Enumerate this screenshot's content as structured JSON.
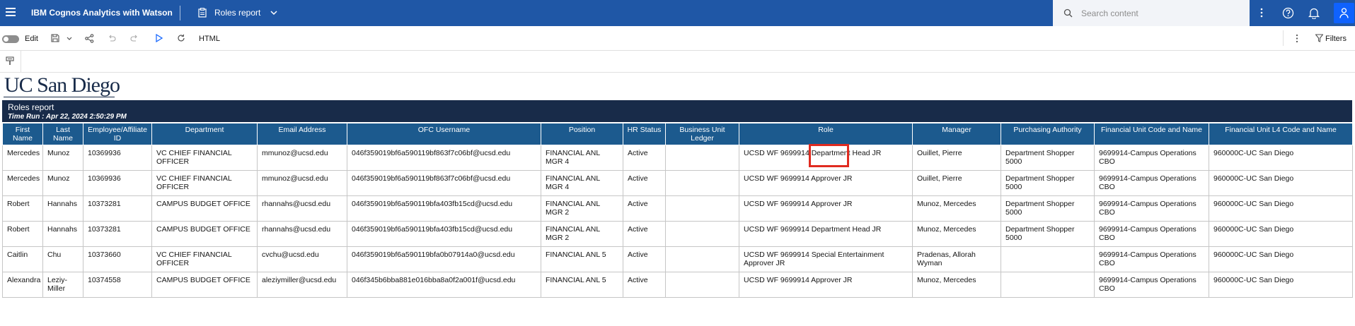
{
  "topbar": {
    "app_name": "IBM Cognos Analytics with Watson",
    "report_title": "Roles report",
    "search_placeholder": "Search content"
  },
  "toolbar": {
    "edit_label": "Edit",
    "output_format": "HTML",
    "filters_label": "Filters"
  },
  "logo": {
    "text": "UC San Diego"
  },
  "report": {
    "title": "Roles report",
    "time_run": "Time Run : Apr 22, 2024 2:50:29 PM"
  },
  "table": {
    "columns": [
      "First Name",
      "Last Name",
      "Employee/Affiliate ID",
      "Department",
      "Email Address",
      "OFC Username",
      "Position",
      "HR Status",
      "Business Unit Ledger",
      "Role",
      "Manager",
      "Purchasing Authority",
      "Financial Unit Code and Name",
      "Financial Unit L4 Code and Name"
    ],
    "rows": [
      [
        "Mercedes",
        "Munoz",
        "10369936",
        "VC CHIEF FINANCIAL OFFICER",
        "mmunoz@ucsd.edu",
        "046f359019bf6a590119bf863f7c06bf@ucsd.edu",
        "FINANCIAL ANL MGR 4",
        "Active",
        "",
        "UCSD WF 9699914 Department Head JR",
        "Ouillet, Pierre",
        "Department Shopper 5000",
        "9699914-Campus Operations CBO",
        "960000C-UC San Diego"
      ],
      [
        "Mercedes",
        "Munoz",
        "10369936",
        "VC CHIEF FINANCIAL OFFICER",
        "mmunoz@ucsd.edu",
        "046f359019bf6a590119bf863f7c06bf@ucsd.edu",
        "FINANCIAL ANL MGR 4",
        "Active",
        "",
        "UCSD WF 9699914 Approver JR",
        "Ouillet, Pierre",
        "Department Shopper 5000",
        "9699914-Campus Operations CBO",
        "960000C-UC San Diego"
      ],
      [
        "Robert",
        "Hannahs",
        "10373281",
        "CAMPUS BUDGET OFFICE",
        "rhannahs@ucsd.edu",
        "046f359019bf6a590119bfa403fb15cd@ucsd.edu",
        "FINANCIAL ANL MGR 2",
        "Active",
        "",
        "UCSD WF 9699914 Approver JR",
        "Munoz, Mercedes",
        "Department Shopper 5000",
        "9699914-Campus Operations CBO",
        "960000C-UC San Diego"
      ],
      [
        "Robert",
        "Hannahs",
        "10373281",
        "CAMPUS BUDGET OFFICE",
        "rhannahs@ucsd.edu",
        "046f359019bf6a590119bfa403fb15cd@ucsd.edu",
        "FINANCIAL ANL MGR 2",
        "Active",
        "",
        "UCSD WF 9699914 Department Head JR",
        "Munoz, Mercedes",
        "Department Shopper 5000",
        "9699914-Campus Operations CBO",
        "960000C-UC San Diego"
      ],
      [
        "Caitlin",
        "Chu",
        "10373660",
        "VC CHIEF FINANCIAL OFFICER",
        "cvchu@ucsd.edu",
        "046f359019bf6a590119bfa0b07914a0@ucsd.edu",
        "FINANCIAL ANL 5",
        "Active",
        "",
        "UCSD WF 9699914 Special Entertainment Approver JR",
        "Pradenas, Allorah Wyman",
        "",
        "9699914-Campus Operations CBO",
        "960000C-UC San Diego"
      ],
      [
        "Alexandra",
        "Leziy-Miller",
        "10374558",
        "CAMPUS BUDGET OFFICE",
        "aleziymiller@ucsd.edu",
        "046f345b6bba881e016bba8a0f2a001f@ucsd.edu",
        "FINANCIAL ANL 5",
        "Active",
        "",
        "UCSD WF 9699914 Approver JR",
        "Munoz, Mercedes",
        "",
        "9699914-Campus Operations CBO",
        "960000C-UC San Diego"
      ]
    ]
  },
  "colors": {
    "topbar": "#1f57a6",
    "report_header": "#182b49",
    "table_header": "#1c5a8e",
    "highlight": "#e02b20"
  }
}
